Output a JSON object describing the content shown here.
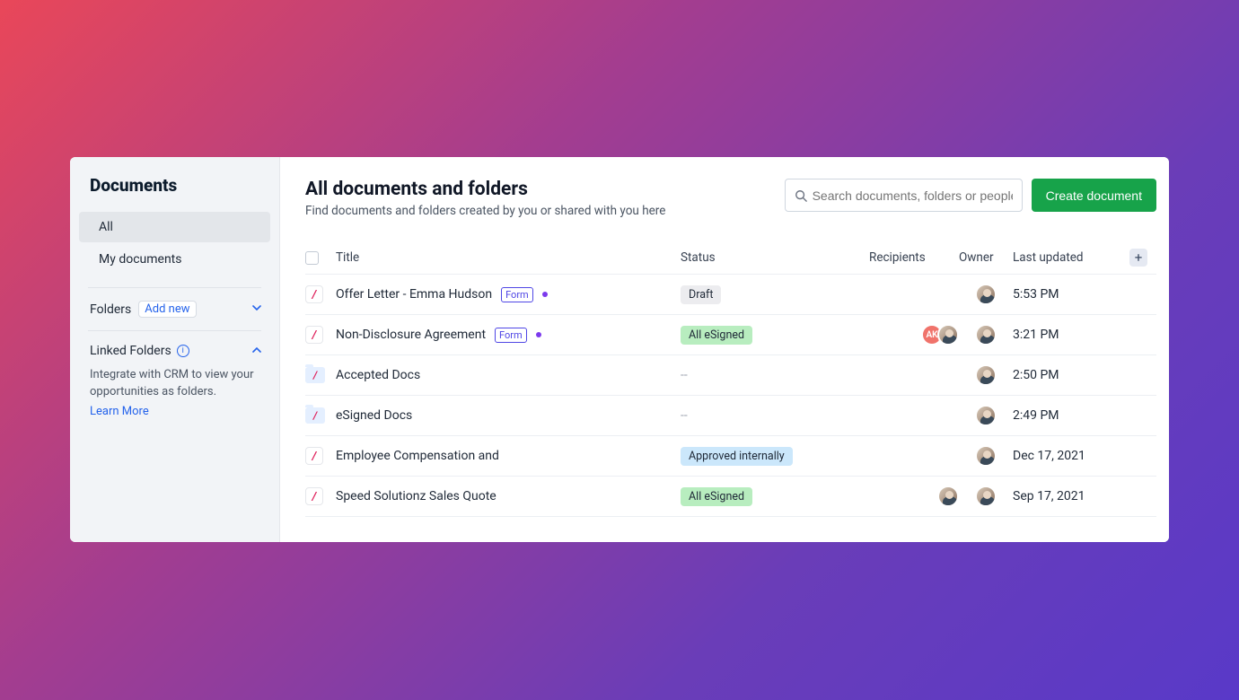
{
  "sidebar": {
    "title": "Documents",
    "nav": [
      {
        "label": "All",
        "active": true
      },
      {
        "label": "My documents",
        "active": false
      }
    ],
    "folders_label": "Folders",
    "add_new_label": "Add new",
    "linked_label": "Linked Folders",
    "linked_desc": "Integrate with CRM to view your opportunities as folders.",
    "learn_more": "Learn More"
  },
  "header": {
    "title": "All documents and folders",
    "subtitle": "Find documents and folders created by you or shared with you here",
    "search_placeholder": "Search documents, folders or people",
    "create_label": "Create document"
  },
  "columns": {
    "title": "Title",
    "status": "Status",
    "recipients": "Recipients",
    "owner": "Owner",
    "last_updated": "Last updated"
  },
  "rows": [
    {
      "type": "doc",
      "title": "Offer Letter - Emma Hudson",
      "form": true,
      "dot": true,
      "status": {
        "label": "Draft",
        "kind": "draft"
      },
      "recipients": [],
      "owner": "person",
      "updated": "5:53 PM"
    },
    {
      "type": "doc",
      "title": "Non-Disclosure Agreement",
      "form": true,
      "dot": true,
      "status": {
        "label": "All eSigned",
        "kind": "esigned"
      },
      "recipients": [
        {
          "kind": "initials",
          "text": "AK"
        },
        {
          "kind": "person"
        }
      ],
      "owner": "person",
      "updated": "3:21 PM"
    },
    {
      "type": "folder",
      "title": "Accepted Docs",
      "status": {
        "label": "--",
        "kind": "dash"
      },
      "recipients": [],
      "owner": "person",
      "updated": "2:50 PM"
    },
    {
      "type": "folder",
      "title": "eSigned Docs",
      "status": {
        "label": "--",
        "kind": "dash"
      },
      "recipients": [],
      "owner": "person",
      "updated": "2:49 PM"
    },
    {
      "type": "doc",
      "title": "Employee Compensation and",
      "status": {
        "label": "Approved internally",
        "kind": "approved"
      },
      "recipients": [],
      "owner": "person",
      "updated": "Dec 17, 2021"
    },
    {
      "type": "doc",
      "title": "Speed Solutionz Sales Quote",
      "status": {
        "label": "All eSigned",
        "kind": "esigned"
      },
      "recipients": [
        {
          "kind": "person"
        }
      ],
      "owner": "person",
      "updated": "Sep 17, 2021"
    }
  ],
  "form_badge": "Form"
}
